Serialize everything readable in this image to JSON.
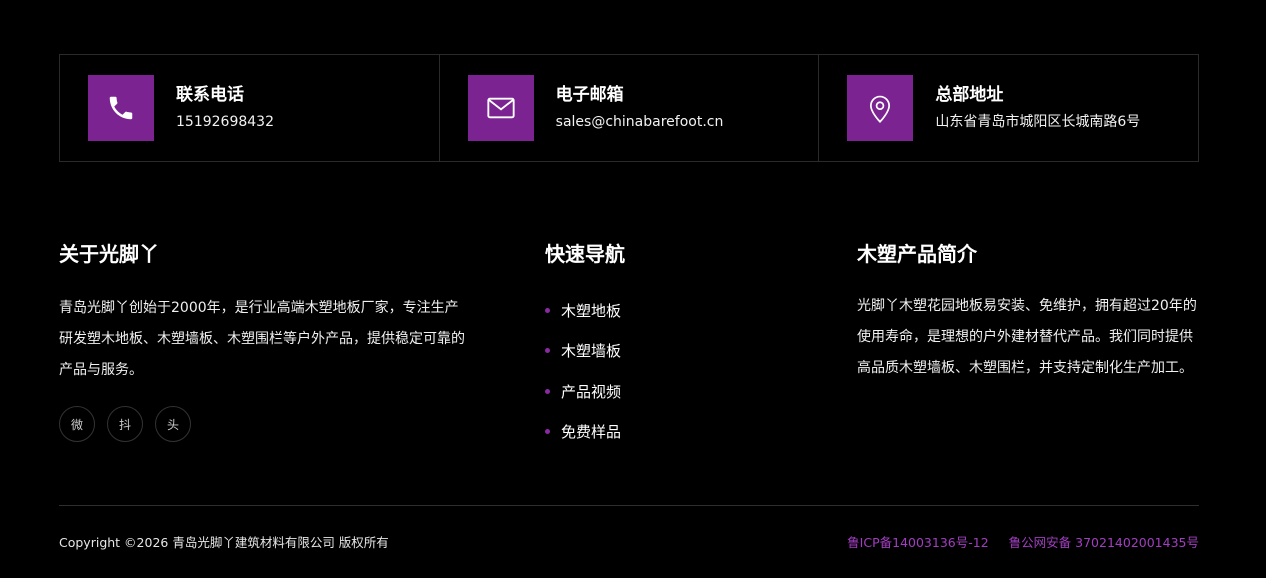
{
  "contacts": [
    {
      "title": "联系电话",
      "value": "15192698432",
      "icon": "phone-icon"
    },
    {
      "title": "电子邮箱",
      "value": "sales@chinabarefoot.cn",
      "icon": "mail-icon"
    },
    {
      "title": "总部地址",
      "value": "山东省青岛市城阳区长城南路6号",
      "icon": "location-pin-icon"
    }
  ],
  "about": {
    "title": "关于光脚丫",
    "text": "青岛光脚丫创始于2000年，是行业高端木塑地板厂家，专注生产研发塑木地板、木塑墙板、木塑围栏等户外产品，提供稳定可靠的产品与服务。",
    "social": [
      "微",
      "抖",
      "头"
    ]
  },
  "nav": {
    "title": "快速导航",
    "items": [
      "木塑地板",
      "木塑墙板",
      "产品视频",
      "免费样品"
    ]
  },
  "intro": {
    "title": "木塑产品简介",
    "text": "光脚丫木塑花园地板易安装、免维护，拥有超过20年的使用寿命，是理想的户外建材替代产品。我们同时提供高品质木塑墙板、木塑围栏，并支持定制化生产加工。"
  },
  "footer": {
    "copyright": "Copyright ©2026 青岛光脚丫建筑材料有限公司 版权所有",
    "icp": "鲁ICP备14003136号-12",
    "police": "鲁公网安备 37021402001435号"
  },
  "colors": {
    "accent": "#7b2491",
    "link": "#a23ec0",
    "background": "#000000"
  }
}
